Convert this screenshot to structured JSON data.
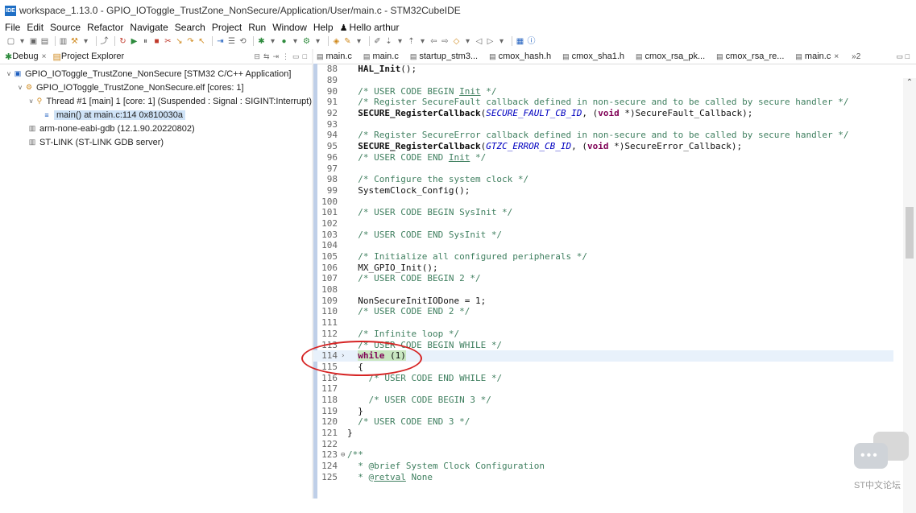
{
  "window": {
    "logo_text": "IDE",
    "title": "workspace_1.13.0 - GPIO_IOToggle_TrustZone_NonSecure/Application/User/main.c - STM32CubeIDE"
  },
  "menu": {
    "items": [
      "File",
      "Edit",
      "Source",
      "Refactor",
      "Navigate",
      "Search",
      "Project",
      "Run",
      "Window",
      "Help"
    ],
    "user": "Hello arthur"
  },
  "left_panel": {
    "tabs": [
      {
        "label": "Debug",
        "icon": "debug-icon",
        "closable": true
      },
      {
        "label": "Project Explorer",
        "icon": "project-explorer-icon",
        "closable": false
      }
    ],
    "tree": [
      {
        "depth": 0,
        "arrow": "v",
        "icon": "c-application-icon",
        "label": "GPIO_IOToggle_TrustZone_NonSecure [STM32 C/C++ Application]",
        "selected": false
      },
      {
        "depth": 1,
        "arrow": "v",
        "icon": "elf-process-icon",
        "label": "GPIO_IOToggle_TrustZone_NonSecure.elf [cores: 1]",
        "selected": false
      },
      {
        "depth": 2,
        "arrow": "v",
        "icon": "thread-suspended-icon",
        "label": "Thread #1 [main] 1 [core: 1] (Suspended : Signal : SIGINT:Interrupt)",
        "selected": false
      },
      {
        "depth": 3,
        "arrow": "",
        "icon": "stack-frame-icon",
        "label": "main() at main.c:114 0x810030a",
        "selected": true
      },
      {
        "depth": 1,
        "arrow": "",
        "icon": "gdb-icon",
        "label": "arm-none-eabi-gdb (12.1.90.20220802)",
        "selected": false
      },
      {
        "depth": 1,
        "arrow": "",
        "icon": "stlink-icon",
        "label": "ST-LINK (ST-LINK GDB server)",
        "selected": false
      }
    ]
  },
  "editor": {
    "tabs": [
      {
        "label": "main.c",
        "active": false
      },
      {
        "label": "main.c",
        "active": false
      },
      {
        "label": "startup_stm3...",
        "active": false
      },
      {
        "label": "cmox_hash.h",
        "active": false
      },
      {
        "label": "cmox_sha1.h",
        "active": false
      },
      {
        "label": "cmox_rsa_pk...",
        "active": false
      },
      {
        "label": "cmox_rsa_re...",
        "active": false
      },
      {
        "label": "main.c",
        "active": true
      }
    ],
    "overflow": "»2",
    "current_line": "114"
  },
  "watermark": {
    "text": "ST中文论坛"
  }
}
